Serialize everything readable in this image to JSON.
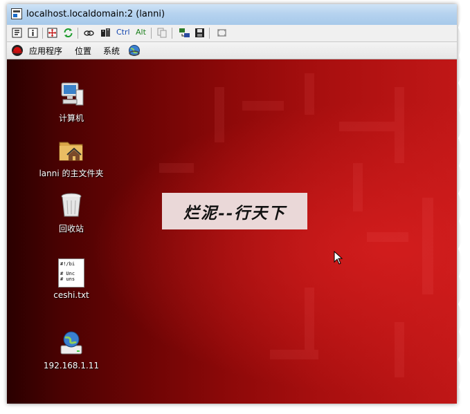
{
  "window": {
    "title": "localhost.localdomain:2 (lanni)"
  },
  "toolbar": {
    "buttons": [
      {
        "name": "options-icon"
      },
      {
        "name": "info-icon"
      },
      {
        "name": "fullscreen-icon"
      },
      {
        "name": "refresh-icon"
      },
      {
        "name": "keys-icon"
      },
      {
        "name": "ctrl-alt-del-icon"
      }
    ],
    "ctrl_label": "Ctrl",
    "alt_label": "Alt",
    "after": [
      {
        "name": "copy-icon"
      },
      {
        "name": "transfer-icon"
      },
      {
        "name": "save-icon"
      },
      {
        "name": "window-mode-icon"
      }
    ]
  },
  "panel": {
    "menus": [
      "应用程序",
      "位置",
      "系统"
    ]
  },
  "desktop": {
    "icons": [
      {
        "label": "计算机",
        "icon": "computer-icon"
      },
      {
        "label": "lanni 的主文件夹",
        "icon": "home-folder-icon"
      },
      {
        "label": "回收站",
        "icon": "trash-icon"
      },
      {
        "label": "ceshi.txt",
        "icon": "text-file-icon",
        "preview": [
          "#!/bi",
          "# Unc",
          "# uns"
        ]
      },
      {
        "label": "192.168.1.11",
        "icon": "network-drive-icon"
      }
    ],
    "banner": "烂泥--行天下"
  },
  "colors": {
    "title_bar": "#b6d3ef",
    "desktop_dark": "#3a0101",
    "desktop_red": "#c01717",
    "banner_bg": "#ead8d8"
  }
}
